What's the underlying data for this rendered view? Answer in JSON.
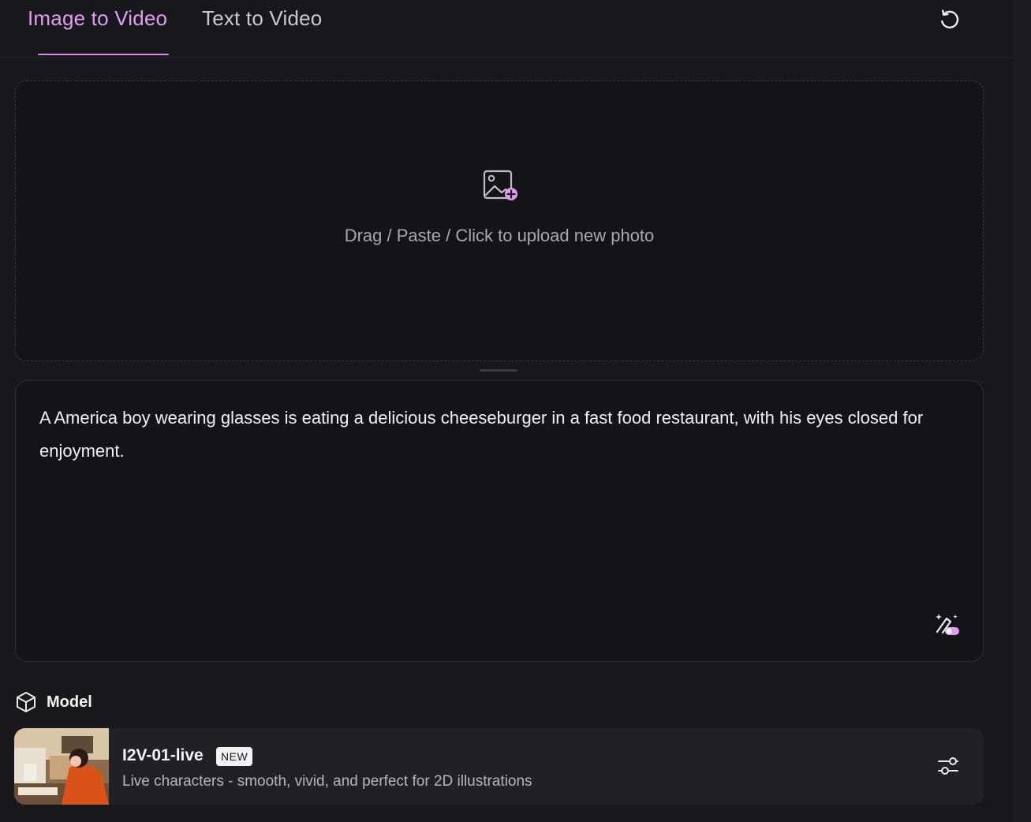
{
  "tabs": {
    "active_label": "Image to Video",
    "inactive_label": "Text to Video"
  },
  "upload": {
    "text": "Drag / Paste / Click to upload new photo"
  },
  "prompt": {
    "text": "A America boy wearing glasses is eating a delicious cheeseburger in a fast food restaurant, with his eyes closed for enjoyment."
  },
  "model_section": {
    "label": "Model"
  },
  "model": {
    "name": "I2V-01-live",
    "badge": "NEW",
    "description": "Live characters - smooth, vivid, and perfect for 2D illustrations"
  },
  "icons": {
    "refresh": "refresh-icon",
    "upload": "image-add-icon",
    "magic": "magic-wand-toggle-icon",
    "model": "cube-icon",
    "settings": "sliders-icon"
  },
  "colors": {
    "accent": "#e39cf2",
    "background": "#17181c",
    "panel": "#131418",
    "card": "#202126"
  }
}
